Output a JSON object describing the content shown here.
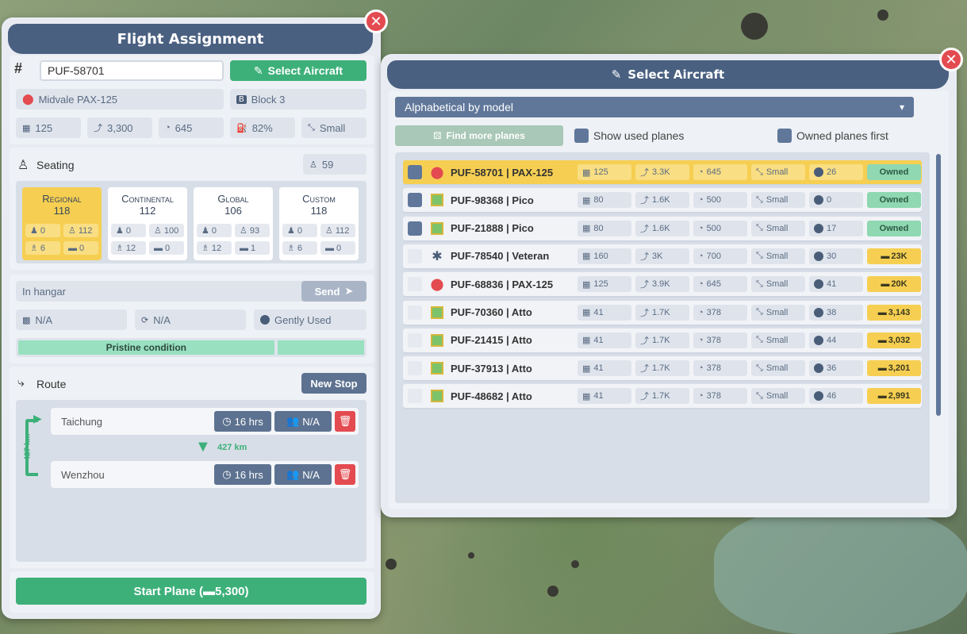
{
  "flight_panel": {
    "title": "Flight Assignment",
    "registration": "PUF-58701",
    "select_button": "Select Aircraft",
    "model": "Midvale PAX-125",
    "block": "Block 3",
    "stats": {
      "seats": "125",
      "range": "3,300",
      "speed": "645",
      "fuel": "82%",
      "size": "Small"
    },
    "seating": {
      "label": "Seating",
      "total": "59",
      "classes": [
        {
          "name": "Regional",
          "count": "118",
          "a": "0",
          "b": "112",
          "c": "6",
          "d": "0"
        },
        {
          "name": "Continental",
          "count": "112",
          "a": "0",
          "b": "100",
          "c": "12",
          "d": "0"
        },
        {
          "name": "Global",
          "count": "106",
          "a": "0",
          "b": "93",
          "c": "12",
          "d": "1"
        },
        {
          "name": "Custom",
          "count": "118",
          "a": "0",
          "b": "112",
          "c": "6",
          "d": "0"
        }
      ]
    },
    "status": {
      "location": "In hangar",
      "send_button": "Send",
      "field_1": "N/A",
      "field_2": "N/A",
      "usage": "Gently Used",
      "condition": "Pristine condition",
      "condition_fraction": 0.74
    },
    "route": {
      "label": "Route",
      "new_stop_button": "New Stop",
      "distance": "427 km",
      "side_distance": "427 km",
      "stops": [
        {
          "name": "Taichung",
          "hours": "16 hrs",
          "pax": "N/A"
        },
        {
          "name": "Wenzhou",
          "hours": "16 hrs",
          "pax": "N/A"
        }
      ]
    },
    "start_button": "Start Plane (",
    "start_amount": "5,300)"
  },
  "select_panel": {
    "title": "Select Aircraft",
    "sort_option": "Alphabetical by model",
    "find_more": "Find more planes",
    "show_used": "Show used planes",
    "owned_first": "Owned planes first",
    "colors": {
      "owned": "#8fd8b1",
      "price": "#f6cf52",
      "selected": "#f6cf52",
      "slate": "#4a6081",
      "green": "#3db07a"
    },
    "aircraft": [
      {
        "name": "PUF-58701 | PAX-125",
        "icon": "red-badge-icon",
        "seats": "125",
        "range": "3.3K",
        "speed": "645",
        "size": "Small",
        "age": "26",
        "tag": "Owned",
        "owned": true,
        "checked": true,
        "selected": true
      },
      {
        "name": "PUF-98368 | Pico",
        "icon": "green-grid-icon",
        "seats": "80",
        "range": "1.6K",
        "speed": "500",
        "size": "Small",
        "age": "0",
        "tag": "Owned",
        "owned": true,
        "checked": true,
        "selected": false
      },
      {
        "name": "PUF-21888 | Pico",
        "icon": "green-grid-icon",
        "seats": "80",
        "range": "1.6K",
        "speed": "500",
        "size": "Small",
        "age": "17",
        "tag": "Owned",
        "owned": true,
        "checked": true,
        "selected": false
      },
      {
        "name": "PUF-78540 | Veteran",
        "icon": "propeller-icon",
        "seats": "160",
        "range": "3K",
        "speed": "700",
        "size": "Small",
        "age": "30",
        "tag": "23K",
        "owned": false,
        "checked": false,
        "selected": false
      },
      {
        "name": "PUF-68836 | PAX-125",
        "icon": "red-badge-icon",
        "seats": "125",
        "range": "3.9K",
        "speed": "645",
        "size": "Small",
        "age": "41",
        "tag": "20K",
        "owned": false,
        "checked": false,
        "selected": false
      },
      {
        "name": "PUF-70360 | Atto",
        "icon": "green-grid-icon",
        "seats": "41",
        "range": "1.7K",
        "speed": "378",
        "size": "Small",
        "age": "38",
        "tag": "3,143",
        "owned": false,
        "checked": false,
        "selected": false
      },
      {
        "name": "PUF-21415 | Atto",
        "icon": "green-grid-icon",
        "seats": "41",
        "range": "1.7K",
        "speed": "378",
        "size": "Small",
        "age": "44",
        "tag": "3,032",
        "owned": false,
        "checked": false,
        "selected": false
      },
      {
        "name": "PUF-37913 | Atto",
        "icon": "green-grid-icon",
        "seats": "41",
        "range": "1.7K",
        "speed": "378",
        "size": "Small",
        "age": "36",
        "tag": "3,201",
        "owned": false,
        "checked": false,
        "selected": false
      },
      {
        "name": "PUF-48682 | Atto",
        "icon": "green-grid-icon",
        "seats": "41",
        "range": "1.7K",
        "speed": "378",
        "size": "Small",
        "age": "46",
        "tag": "2,991",
        "owned": false,
        "checked": false,
        "selected": false
      }
    ]
  }
}
